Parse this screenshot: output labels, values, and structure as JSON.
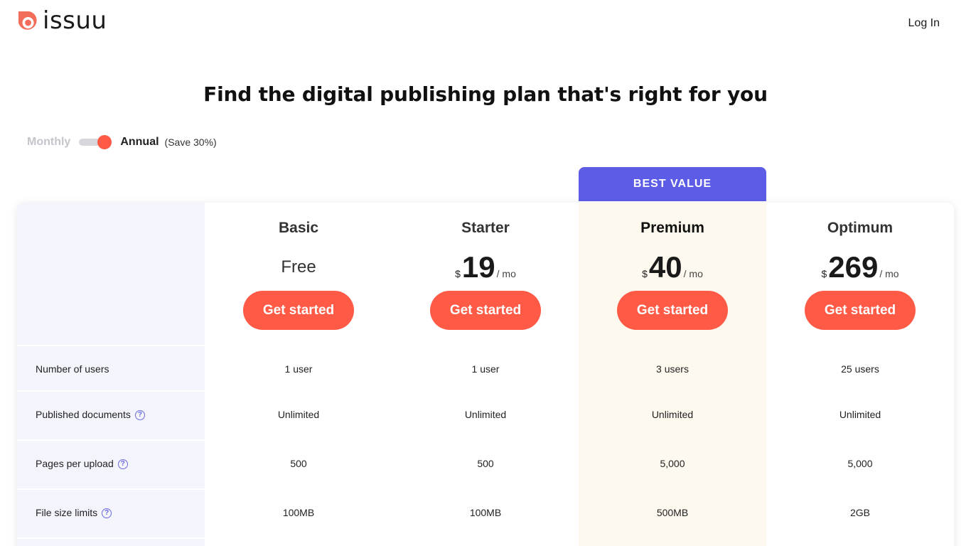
{
  "header": {
    "brand": "issuu",
    "login_label": "Log In",
    "brand_color": "#f36d5b"
  },
  "page_title": "Find the digital publishing plan that's right for you",
  "billing": {
    "monthly_label": "Monthly",
    "annual_label": "Annual",
    "save_note": "(Save 30%)",
    "selected": "Annual"
  },
  "best_value_label": "BEST VALUE",
  "plans": [
    {
      "name": "Basic",
      "price_text": "Free",
      "currency": "",
      "amount": "",
      "period": "",
      "cta": "Get started"
    },
    {
      "name": "Starter",
      "price_text": "",
      "currency": "$",
      "amount": "19",
      "period": "/ mo",
      "cta": "Get started"
    },
    {
      "name": "Premium",
      "price_text": "",
      "currency": "$",
      "amount": "40",
      "period": "/ mo",
      "cta": "Get started"
    },
    {
      "name": "Optimum",
      "price_text": "",
      "currency": "$",
      "amount": "269",
      "period": "/ mo",
      "cta": "Get started"
    }
  ],
  "features": [
    {
      "label": "Number of users",
      "help": false,
      "values": [
        "1 user",
        "1 user",
        "3 users",
        "25 users"
      ]
    },
    {
      "label": "Published documents",
      "help": true,
      "values": [
        "Unlimited",
        "Unlimited",
        "Unlimited",
        "Unlimited"
      ]
    },
    {
      "label": "Pages per upload",
      "help": true,
      "values": [
        "500",
        "500",
        "5,000",
        "5,000"
      ]
    },
    {
      "label": "File size limits",
      "help": true,
      "values": [
        "100MB",
        "100MB",
        "500MB",
        "2GB"
      ]
    }
  ],
  "help_icon_glyph": "?",
  "colors": {
    "accent": "#ff5a46",
    "best_value_bg": "#5c5ce6",
    "label_column_bg": "#f4f4fc",
    "premium_column_bg": "#fef9ee"
  }
}
